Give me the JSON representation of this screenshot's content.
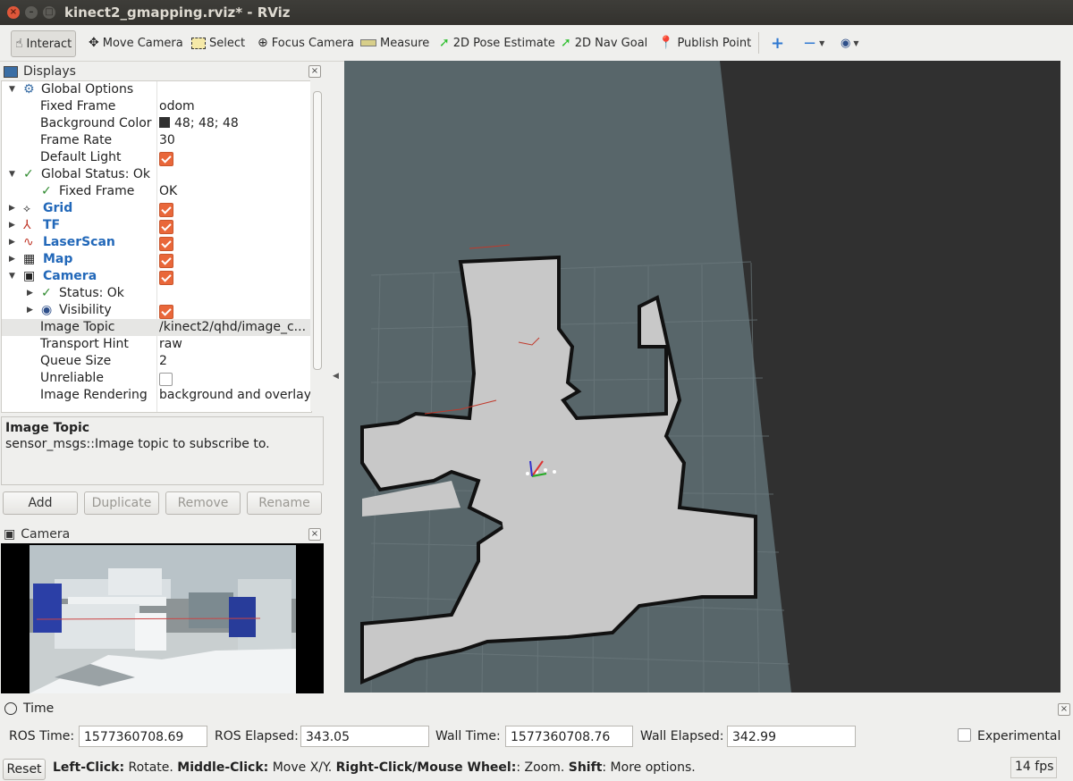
{
  "window": {
    "title": "kinect2_gmapping.rviz* - RViz"
  },
  "toolbar": {
    "interact": "Interact",
    "move_camera": "Move Camera",
    "select": "Select",
    "focus_camera": "Focus Camera",
    "measure": "Measure",
    "pose_estimate": "2D Pose Estimate",
    "nav_goal": "2D Nav Goal",
    "publish_point": "Publish Point"
  },
  "displays": {
    "title": "Displays",
    "rows": {
      "global_options": "Global Options",
      "fixed_frame_label": "Fixed Frame",
      "fixed_frame_value": "odom",
      "bg_color_label": "Background Color",
      "bg_color_value": "48; 48; 48",
      "frame_rate_label": "Frame Rate",
      "frame_rate_value": "30",
      "default_light_label": "Default Light",
      "global_status": "Global Status: Ok",
      "gs_fixed_frame_label": "Fixed Frame",
      "gs_fixed_frame_value": "OK",
      "grid": "Grid",
      "tf": "TF",
      "laserscan": "LaserScan",
      "map": "Map",
      "camera": "Camera",
      "status_ok": "Status: Ok",
      "visibility": "Visibility",
      "image_topic_label": "Image Topic",
      "image_topic_value": "/kinect2/qhd/image_c...",
      "transport_hint_label": "Transport Hint",
      "transport_hint_value": "raw",
      "queue_size_label": "Queue Size",
      "queue_size_value": "2",
      "unreliable_label": "Unreliable",
      "image_rendering_label": "Image Rendering",
      "image_rendering_value": "background and overlay"
    },
    "colors": {
      "background_swatch": "#303030",
      "accent": "#2268b9",
      "checkbox": "#e9673a"
    }
  },
  "description": {
    "title": "Image Topic",
    "text": "sensor_msgs::Image topic to subscribe to."
  },
  "buttons": {
    "add": "Add",
    "duplicate": "Duplicate",
    "remove": "Remove",
    "rename": "Rename"
  },
  "camera_panel": {
    "title": "Camera"
  },
  "time_panel": {
    "title": "Time",
    "ros_time_label": "ROS Time:",
    "ros_time_value": "1577360708.69",
    "ros_elapsed_label": "ROS Elapsed:",
    "ros_elapsed_value": "343.05",
    "wall_time_label": "Wall Time:",
    "wall_time_value": "1577360708.76",
    "wall_elapsed_label": "Wall Elapsed:",
    "wall_elapsed_value": "342.99",
    "experimental": "Experimental"
  },
  "status": {
    "reset": "Reset",
    "left_click": "Left-Click:",
    "left_click_text": " Rotate. ",
    "middle_click": "Middle-Click:",
    "middle_click_text": " Move X/Y. ",
    "right_click": "Right-Click/Mouse Wheel:",
    "right_click_text": ": Zoom. ",
    "shift": "Shift",
    "shift_text": ": More options.",
    "fps": "14 fps"
  }
}
